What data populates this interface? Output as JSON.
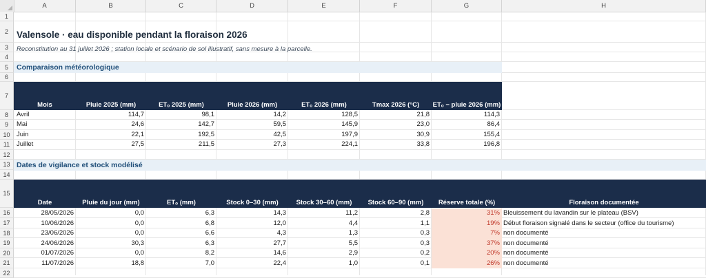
{
  "columns": [
    "A",
    "B",
    "C",
    "D",
    "E",
    "F",
    "G",
    "H"
  ],
  "rows": [
    "1",
    "2",
    "3",
    "4",
    "5",
    "6",
    "7",
    "8",
    "9",
    "10",
    "11",
    "12",
    "13",
    "14",
    "15",
    "16",
    "17",
    "18",
    "19",
    "20",
    "21",
    "22"
  ],
  "title": "Valensole · eau disponible pendant la floraison 2026",
  "subtitle": "Reconstitution au 31 juillet 2026 ; station locale et scénario de sol illustratif, sans mesure à la parcelle.",
  "meteo": {
    "section_title": "Comparaison météorologique",
    "headers": [
      "Mois",
      "Pluie 2025 (mm)",
      "ETₒ 2025 (mm)",
      "Pluie 2026 (mm)",
      "ETₒ 2026 (mm)",
      "Tmax 2026 (°C)",
      "ETₒ − pluie 2026 (mm)"
    ],
    "rows": [
      [
        "Avril",
        "114,7",
        "98,1",
        "14,2",
        "128,5",
        "21,8",
        "114,3"
      ],
      [
        "Mai",
        "24,6",
        "142,7",
        "59,5",
        "145,9",
        "23,0",
        "86,4"
      ],
      [
        "Juin",
        "22,1",
        "192,5",
        "42,5",
        "197,9",
        "30,9",
        "155,4"
      ],
      [
        "Juillet",
        "27,5",
        "211,5",
        "27,3",
        "224,1",
        "33,8",
        "196,8"
      ]
    ]
  },
  "vigilance": {
    "section_title": "Dates de vigilance et stock modélisé",
    "headers": [
      "Date",
      "Pluie du jour (mm)",
      "ETₒ (mm)",
      "Stock 0–30 (mm)",
      "Stock 30–60 (mm)",
      "Stock 60–90 (mm)",
      "Réserve totale (%)",
      "Floraison documentée"
    ],
    "rows": [
      [
        "28/05/2026",
        "0,0",
        "6,3",
        "14,3",
        "11,2",
        "2,8",
        "31%",
        "Bleuissement du lavandin sur le plateau (BSV)"
      ],
      [
        "10/06/2026",
        "0,0",
        "6,8",
        "12,0",
        "4,4",
        "1,1",
        "19%",
        "Début floraison signalé dans le secteur (office du tourisme)"
      ],
      [
        "23/06/2026",
        "0,0",
        "6,6",
        "4,3",
        "1,3",
        "0,3",
        "7%",
        "non documenté"
      ],
      [
        "24/06/2026",
        "30,3",
        "6,3",
        "27,7",
        "5,5",
        "0,3",
        "37%",
        "non documenté"
      ],
      [
        "01/07/2026",
        "0,0",
        "8,2",
        "14,6",
        "2,9",
        "0,2",
        "20%",
        "non documenté"
      ],
      [
        "11/07/2026",
        "18,8",
        "7,0",
        "22,4",
        "1,0",
        "0,1",
        "26%",
        "non documenté"
      ]
    ]
  },
  "colors": {
    "header_navy": "#1b2d4a",
    "section_band": "#e8f0f7",
    "reserve_fill": "#fbe1d6",
    "percent_text": "#c0392b"
  }
}
